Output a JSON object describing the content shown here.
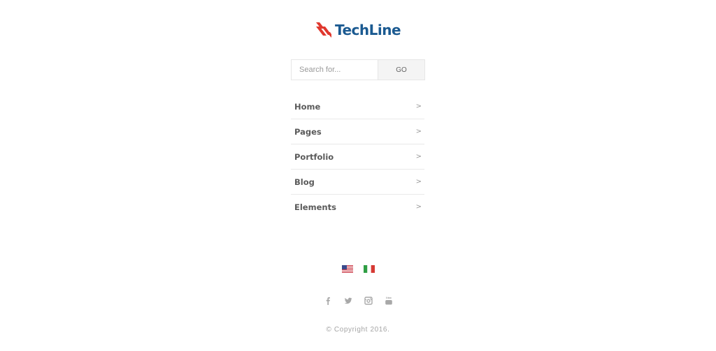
{
  "brand": {
    "name": "TechLine",
    "logo_icon": "techline-stripes-logo-icon",
    "accent_color": "#e0382e",
    "text_color": "#1b5a91"
  },
  "search": {
    "placeholder": "Search for...",
    "value": "",
    "button_label": "GO"
  },
  "menu": {
    "items": [
      {
        "label": "Home",
        "chevron": ">"
      },
      {
        "label": "Pages",
        "chevron": ">"
      },
      {
        "label": "Portfolio",
        "chevron": ">"
      },
      {
        "label": "Blog",
        "chevron": ">"
      },
      {
        "label": "Elements",
        "chevron": ">"
      }
    ]
  },
  "languages": {
    "flags": [
      "us-flag-icon",
      "italy-flag-icon"
    ]
  },
  "social": {
    "icons": [
      "facebook-icon",
      "twitter-icon",
      "instagram-icon",
      "youtube-icon"
    ],
    "icon_color": "#a8a8a8"
  },
  "footer": {
    "copyright": "© Copyright 2016."
  }
}
